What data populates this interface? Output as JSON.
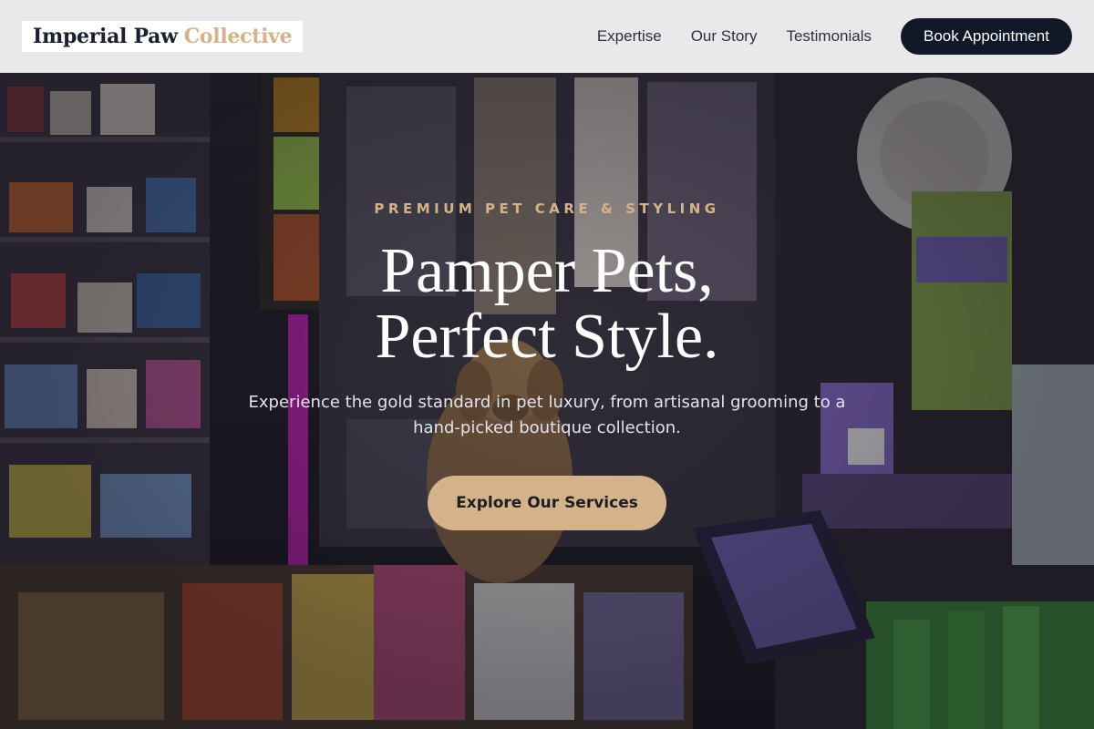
{
  "brand": {
    "name_part1": "Imperial Paw",
    "name_part2": "Collective"
  },
  "nav": {
    "links": [
      {
        "label": "Expertise"
      },
      {
        "label": "Our Story"
      },
      {
        "label": "Testimonials"
      }
    ],
    "cta_label": "Book Appointment"
  },
  "hero": {
    "eyebrow": "PREMIUM PET CARE & STYLING",
    "headline_line1": "Pamper Pets,",
    "headline_line2": "Perfect Style.",
    "subtext": "Experience the gold standard in pet luxury, from artisanal grooming to a hand-picked boutique collection.",
    "cta_label": "Explore Our Services",
    "background_image": "shop-interior-with-poodle"
  },
  "colors": {
    "accent_gold": "#d4b38a",
    "dark_navy": "#111827",
    "header_bg": "#f7f7f9",
    "text_white": "#ffffff"
  }
}
